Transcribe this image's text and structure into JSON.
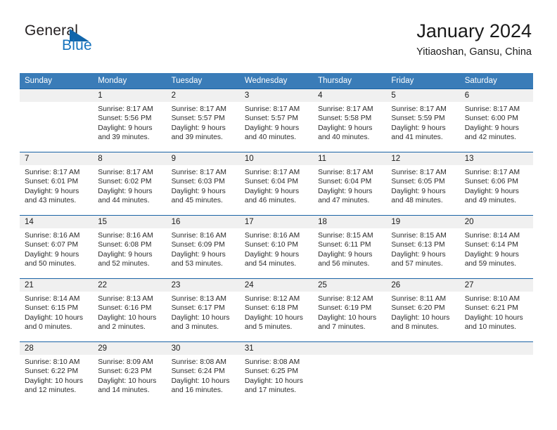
{
  "brand": {
    "name_part1": "General",
    "name_part2": "Blue",
    "triangle_icon": "triangle-icon"
  },
  "header": {
    "title": "January 2024",
    "subtitle": "Yitiaoshan, Gansu, China"
  },
  "colors": {
    "header_blue": "#3a7cb8",
    "rule_blue": "#1a63a5",
    "brand_blue": "#1673bd",
    "number_band": "#f0f0f0"
  },
  "day_headers": [
    "Sunday",
    "Monday",
    "Tuesday",
    "Wednesday",
    "Thursday",
    "Friday",
    "Saturday"
  ],
  "weeks": [
    {
      "days": [
        {
          "num": "",
          "sunrise": "",
          "sunset": "",
          "daylight": "",
          "daylight2": ""
        },
        {
          "num": "1",
          "sunrise": "Sunrise: 8:17 AM",
          "sunset": "Sunset: 5:56 PM",
          "daylight": "Daylight: 9 hours",
          "daylight2": "and 39 minutes."
        },
        {
          "num": "2",
          "sunrise": "Sunrise: 8:17 AM",
          "sunset": "Sunset: 5:57 PM",
          "daylight": "Daylight: 9 hours",
          "daylight2": "and 39 minutes."
        },
        {
          "num": "3",
          "sunrise": "Sunrise: 8:17 AM",
          "sunset": "Sunset: 5:57 PM",
          "daylight": "Daylight: 9 hours",
          "daylight2": "and 40 minutes."
        },
        {
          "num": "4",
          "sunrise": "Sunrise: 8:17 AM",
          "sunset": "Sunset: 5:58 PM",
          "daylight": "Daylight: 9 hours",
          "daylight2": "and 40 minutes."
        },
        {
          "num": "5",
          "sunrise": "Sunrise: 8:17 AM",
          "sunset": "Sunset: 5:59 PM",
          "daylight": "Daylight: 9 hours",
          "daylight2": "and 41 minutes."
        },
        {
          "num": "6",
          "sunrise": "Sunrise: 8:17 AM",
          "sunset": "Sunset: 6:00 PM",
          "daylight": "Daylight: 9 hours",
          "daylight2": "and 42 minutes."
        }
      ]
    },
    {
      "days": [
        {
          "num": "7",
          "sunrise": "Sunrise: 8:17 AM",
          "sunset": "Sunset: 6:01 PM",
          "daylight": "Daylight: 9 hours",
          "daylight2": "and 43 minutes."
        },
        {
          "num": "8",
          "sunrise": "Sunrise: 8:17 AM",
          "sunset": "Sunset: 6:02 PM",
          "daylight": "Daylight: 9 hours",
          "daylight2": "and 44 minutes."
        },
        {
          "num": "9",
          "sunrise": "Sunrise: 8:17 AM",
          "sunset": "Sunset: 6:03 PM",
          "daylight": "Daylight: 9 hours",
          "daylight2": "and 45 minutes."
        },
        {
          "num": "10",
          "sunrise": "Sunrise: 8:17 AM",
          "sunset": "Sunset: 6:04 PM",
          "daylight": "Daylight: 9 hours",
          "daylight2": "and 46 minutes."
        },
        {
          "num": "11",
          "sunrise": "Sunrise: 8:17 AM",
          "sunset": "Sunset: 6:04 PM",
          "daylight": "Daylight: 9 hours",
          "daylight2": "and 47 minutes."
        },
        {
          "num": "12",
          "sunrise": "Sunrise: 8:17 AM",
          "sunset": "Sunset: 6:05 PM",
          "daylight": "Daylight: 9 hours",
          "daylight2": "and 48 minutes."
        },
        {
          "num": "13",
          "sunrise": "Sunrise: 8:17 AM",
          "sunset": "Sunset: 6:06 PM",
          "daylight": "Daylight: 9 hours",
          "daylight2": "and 49 minutes."
        }
      ]
    },
    {
      "days": [
        {
          "num": "14",
          "sunrise": "Sunrise: 8:16 AM",
          "sunset": "Sunset: 6:07 PM",
          "daylight": "Daylight: 9 hours",
          "daylight2": "and 50 minutes."
        },
        {
          "num": "15",
          "sunrise": "Sunrise: 8:16 AM",
          "sunset": "Sunset: 6:08 PM",
          "daylight": "Daylight: 9 hours",
          "daylight2": "and 52 minutes."
        },
        {
          "num": "16",
          "sunrise": "Sunrise: 8:16 AM",
          "sunset": "Sunset: 6:09 PM",
          "daylight": "Daylight: 9 hours",
          "daylight2": "and 53 minutes."
        },
        {
          "num": "17",
          "sunrise": "Sunrise: 8:16 AM",
          "sunset": "Sunset: 6:10 PM",
          "daylight": "Daylight: 9 hours",
          "daylight2": "and 54 minutes."
        },
        {
          "num": "18",
          "sunrise": "Sunrise: 8:15 AM",
          "sunset": "Sunset: 6:11 PM",
          "daylight": "Daylight: 9 hours",
          "daylight2": "and 56 minutes."
        },
        {
          "num": "19",
          "sunrise": "Sunrise: 8:15 AM",
          "sunset": "Sunset: 6:13 PM",
          "daylight": "Daylight: 9 hours",
          "daylight2": "and 57 minutes."
        },
        {
          "num": "20",
          "sunrise": "Sunrise: 8:14 AM",
          "sunset": "Sunset: 6:14 PM",
          "daylight": "Daylight: 9 hours",
          "daylight2": "and 59 minutes."
        }
      ]
    },
    {
      "days": [
        {
          "num": "21",
          "sunrise": "Sunrise: 8:14 AM",
          "sunset": "Sunset: 6:15 PM",
          "daylight": "Daylight: 10 hours",
          "daylight2": "and 0 minutes."
        },
        {
          "num": "22",
          "sunrise": "Sunrise: 8:13 AM",
          "sunset": "Sunset: 6:16 PM",
          "daylight": "Daylight: 10 hours",
          "daylight2": "and 2 minutes."
        },
        {
          "num": "23",
          "sunrise": "Sunrise: 8:13 AM",
          "sunset": "Sunset: 6:17 PM",
          "daylight": "Daylight: 10 hours",
          "daylight2": "and 3 minutes."
        },
        {
          "num": "24",
          "sunrise": "Sunrise: 8:12 AM",
          "sunset": "Sunset: 6:18 PM",
          "daylight": "Daylight: 10 hours",
          "daylight2": "and 5 minutes."
        },
        {
          "num": "25",
          "sunrise": "Sunrise: 8:12 AM",
          "sunset": "Sunset: 6:19 PM",
          "daylight": "Daylight: 10 hours",
          "daylight2": "and 7 minutes."
        },
        {
          "num": "26",
          "sunrise": "Sunrise: 8:11 AM",
          "sunset": "Sunset: 6:20 PM",
          "daylight": "Daylight: 10 hours",
          "daylight2": "and 8 minutes."
        },
        {
          "num": "27",
          "sunrise": "Sunrise: 8:10 AM",
          "sunset": "Sunset: 6:21 PM",
          "daylight": "Daylight: 10 hours",
          "daylight2": "and 10 minutes."
        }
      ]
    },
    {
      "days": [
        {
          "num": "28",
          "sunrise": "Sunrise: 8:10 AM",
          "sunset": "Sunset: 6:22 PM",
          "daylight": "Daylight: 10 hours",
          "daylight2": "and 12 minutes."
        },
        {
          "num": "29",
          "sunrise": "Sunrise: 8:09 AM",
          "sunset": "Sunset: 6:23 PM",
          "daylight": "Daylight: 10 hours",
          "daylight2": "and 14 minutes."
        },
        {
          "num": "30",
          "sunrise": "Sunrise: 8:08 AM",
          "sunset": "Sunset: 6:24 PM",
          "daylight": "Daylight: 10 hours",
          "daylight2": "and 16 minutes."
        },
        {
          "num": "31",
          "sunrise": "Sunrise: 8:08 AM",
          "sunset": "Sunset: 6:25 PM",
          "daylight": "Daylight: 10 hours",
          "daylight2": "and 17 minutes."
        },
        {
          "num": "",
          "sunrise": "",
          "sunset": "",
          "daylight": "",
          "daylight2": ""
        },
        {
          "num": "",
          "sunrise": "",
          "sunset": "",
          "daylight": "",
          "daylight2": ""
        },
        {
          "num": "",
          "sunrise": "",
          "sunset": "",
          "daylight": "",
          "daylight2": ""
        }
      ]
    }
  ]
}
